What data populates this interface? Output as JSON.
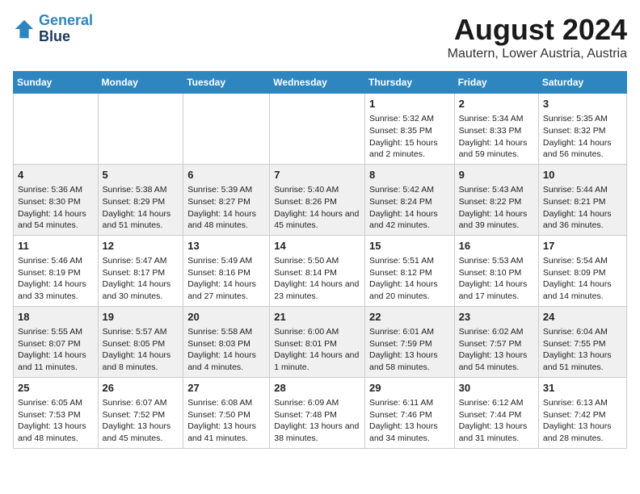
{
  "logo": {
    "line1": "General",
    "line2": "Blue"
  },
  "title": "August 2024",
  "subtitle": "Mautern, Lower Austria, Austria",
  "days_of_week": [
    "Sunday",
    "Monday",
    "Tuesday",
    "Wednesday",
    "Thursday",
    "Friday",
    "Saturday"
  ],
  "weeks": [
    [
      {
        "day": "",
        "data": ""
      },
      {
        "day": "",
        "data": ""
      },
      {
        "day": "",
        "data": ""
      },
      {
        "day": "",
        "data": ""
      },
      {
        "day": "1",
        "data": "Sunrise: 5:32 AM\nSunset: 8:35 PM\nDaylight: 15 hours and 2 minutes."
      },
      {
        "day": "2",
        "data": "Sunrise: 5:34 AM\nSunset: 8:33 PM\nDaylight: 14 hours and 59 minutes."
      },
      {
        "day": "3",
        "data": "Sunrise: 5:35 AM\nSunset: 8:32 PM\nDaylight: 14 hours and 56 minutes."
      }
    ],
    [
      {
        "day": "4",
        "data": "Sunrise: 5:36 AM\nSunset: 8:30 PM\nDaylight: 14 hours and 54 minutes."
      },
      {
        "day": "5",
        "data": "Sunrise: 5:38 AM\nSunset: 8:29 PM\nDaylight: 14 hours and 51 minutes."
      },
      {
        "day": "6",
        "data": "Sunrise: 5:39 AM\nSunset: 8:27 PM\nDaylight: 14 hours and 48 minutes."
      },
      {
        "day": "7",
        "data": "Sunrise: 5:40 AM\nSunset: 8:26 PM\nDaylight: 14 hours and 45 minutes."
      },
      {
        "day": "8",
        "data": "Sunrise: 5:42 AM\nSunset: 8:24 PM\nDaylight: 14 hours and 42 minutes."
      },
      {
        "day": "9",
        "data": "Sunrise: 5:43 AM\nSunset: 8:22 PM\nDaylight: 14 hours and 39 minutes."
      },
      {
        "day": "10",
        "data": "Sunrise: 5:44 AM\nSunset: 8:21 PM\nDaylight: 14 hours and 36 minutes."
      }
    ],
    [
      {
        "day": "11",
        "data": "Sunrise: 5:46 AM\nSunset: 8:19 PM\nDaylight: 14 hours and 33 minutes."
      },
      {
        "day": "12",
        "data": "Sunrise: 5:47 AM\nSunset: 8:17 PM\nDaylight: 14 hours and 30 minutes."
      },
      {
        "day": "13",
        "data": "Sunrise: 5:49 AM\nSunset: 8:16 PM\nDaylight: 14 hours and 27 minutes."
      },
      {
        "day": "14",
        "data": "Sunrise: 5:50 AM\nSunset: 8:14 PM\nDaylight: 14 hours and 23 minutes."
      },
      {
        "day": "15",
        "data": "Sunrise: 5:51 AM\nSunset: 8:12 PM\nDaylight: 14 hours and 20 minutes."
      },
      {
        "day": "16",
        "data": "Sunrise: 5:53 AM\nSunset: 8:10 PM\nDaylight: 14 hours and 17 minutes."
      },
      {
        "day": "17",
        "data": "Sunrise: 5:54 AM\nSunset: 8:09 PM\nDaylight: 14 hours and 14 minutes."
      }
    ],
    [
      {
        "day": "18",
        "data": "Sunrise: 5:55 AM\nSunset: 8:07 PM\nDaylight: 14 hours and 11 minutes."
      },
      {
        "day": "19",
        "data": "Sunrise: 5:57 AM\nSunset: 8:05 PM\nDaylight: 14 hours and 8 minutes."
      },
      {
        "day": "20",
        "data": "Sunrise: 5:58 AM\nSunset: 8:03 PM\nDaylight: 14 hours and 4 minutes."
      },
      {
        "day": "21",
        "data": "Sunrise: 6:00 AM\nSunset: 8:01 PM\nDaylight: 14 hours and 1 minute."
      },
      {
        "day": "22",
        "data": "Sunrise: 6:01 AM\nSunset: 7:59 PM\nDaylight: 13 hours and 58 minutes."
      },
      {
        "day": "23",
        "data": "Sunrise: 6:02 AM\nSunset: 7:57 PM\nDaylight: 13 hours and 54 minutes."
      },
      {
        "day": "24",
        "data": "Sunrise: 6:04 AM\nSunset: 7:55 PM\nDaylight: 13 hours and 51 minutes."
      }
    ],
    [
      {
        "day": "25",
        "data": "Sunrise: 6:05 AM\nSunset: 7:53 PM\nDaylight: 13 hours and 48 minutes."
      },
      {
        "day": "26",
        "data": "Sunrise: 6:07 AM\nSunset: 7:52 PM\nDaylight: 13 hours and 45 minutes."
      },
      {
        "day": "27",
        "data": "Sunrise: 6:08 AM\nSunset: 7:50 PM\nDaylight: 13 hours and 41 minutes."
      },
      {
        "day": "28",
        "data": "Sunrise: 6:09 AM\nSunset: 7:48 PM\nDaylight: 13 hours and 38 minutes."
      },
      {
        "day": "29",
        "data": "Sunrise: 6:11 AM\nSunset: 7:46 PM\nDaylight: 13 hours and 34 minutes."
      },
      {
        "day": "30",
        "data": "Sunrise: 6:12 AM\nSunset: 7:44 PM\nDaylight: 13 hours and 31 minutes."
      },
      {
        "day": "31",
        "data": "Sunrise: 6:13 AM\nSunset: 7:42 PM\nDaylight: 13 hours and 28 minutes."
      }
    ]
  ]
}
